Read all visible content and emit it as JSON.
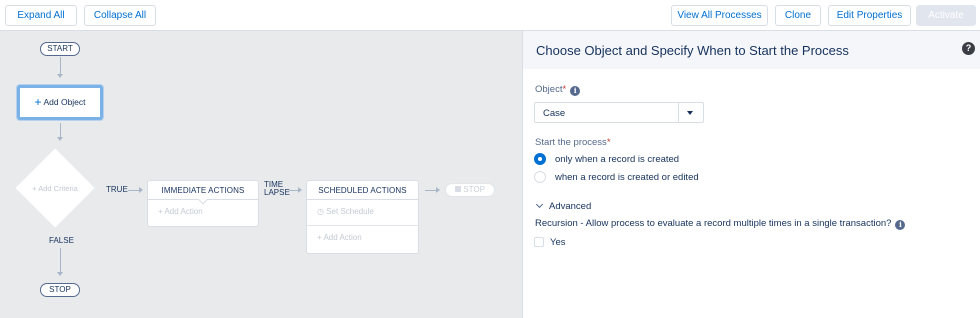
{
  "toolbar": {
    "expand_all": "Expand All",
    "collapse_all": "Collapse All",
    "view_all_processes": "View All Processes",
    "clone": "Clone",
    "edit_properties": "Edit Properties",
    "activate": "Activate"
  },
  "canvas": {
    "start": "START",
    "add_object": "Add Object",
    "add_criteria": "Add Criteria",
    "true_label": "TRUE",
    "false_label": "FALSE",
    "stop": "STOP",
    "immediate_actions": "IMMEDIATE ACTIONS",
    "add_action": "Add Action",
    "time_lapse_1": "TIME",
    "time_lapse_2": "LAPSE",
    "scheduled_actions": "SCHEDULED ACTIONS",
    "set_schedule": "Set Schedule",
    "stop_ghost": "STOP"
  },
  "panel": {
    "title": "Choose Object and Specify When to Start the Process",
    "object_label": "Object",
    "object_value": "Case",
    "start_label": "Start the process",
    "radio_options": [
      "only when a record is created",
      "when a record is created or edited"
    ],
    "selected_option": 0,
    "advanced": "Advanced",
    "recursion_label": "Recursion - Allow process to evaluate a record multiple times in a single transaction?",
    "yes": "Yes"
  },
  "colors": {
    "accent": "#0070d2",
    "text": "#16325c",
    "canvas_bg": "#e9eaec",
    "required": "#c23934"
  },
  "icons": [
    "help-icon",
    "info-icon",
    "chevron-down-icon",
    "plus-icon",
    "clock-icon",
    "stop-icon"
  ]
}
